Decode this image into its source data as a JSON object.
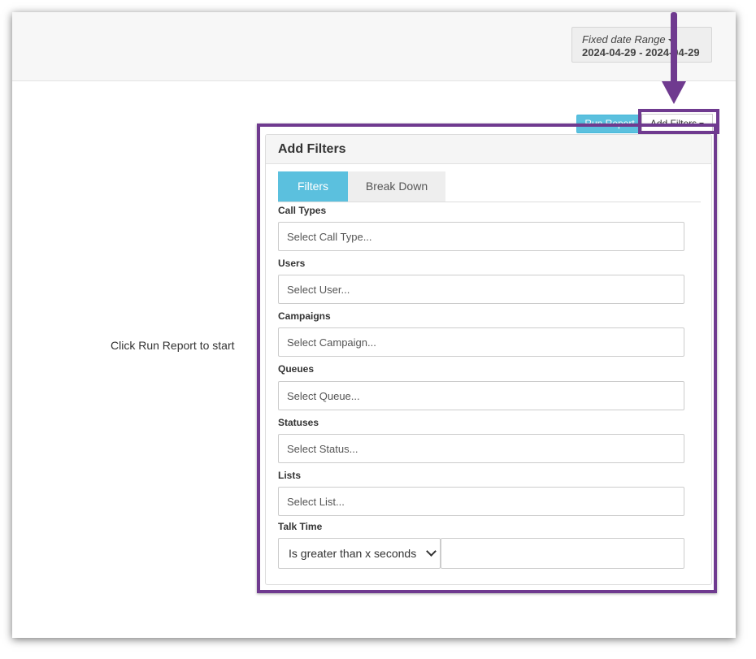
{
  "header": {
    "date_range_label": "Fixed date Range",
    "date_range_value": "2024-04-29 - 2024-04-29"
  },
  "toolbar": {
    "run_report_label": "Run Report",
    "add_filters_label": "Add Filters"
  },
  "main": {
    "hint": "Click Run Report to start"
  },
  "panel": {
    "title": "Add Filters",
    "tabs": [
      {
        "label": "Filters",
        "active": true
      },
      {
        "label": "Break Down",
        "active": false
      }
    ],
    "fields": [
      {
        "label": "Call Types",
        "placeholder": "Select Call Type..."
      },
      {
        "label": "Users",
        "placeholder": "Select User..."
      },
      {
        "label": "Campaigns",
        "placeholder": "Select Campaign..."
      },
      {
        "label": "Queues",
        "placeholder": "Select Queue..."
      },
      {
        "label": "Statuses",
        "placeholder": "Select Status..."
      },
      {
        "label": "Lists",
        "placeholder": "Select List..."
      }
    ],
    "talk_time": {
      "label": "Talk Time",
      "selected": "Is greater than x seconds",
      "value": ""
    }
  },
  "colors": {
    "accent": "#5bc0de",
    "annotation": "#6f3a8f"
  }
}
